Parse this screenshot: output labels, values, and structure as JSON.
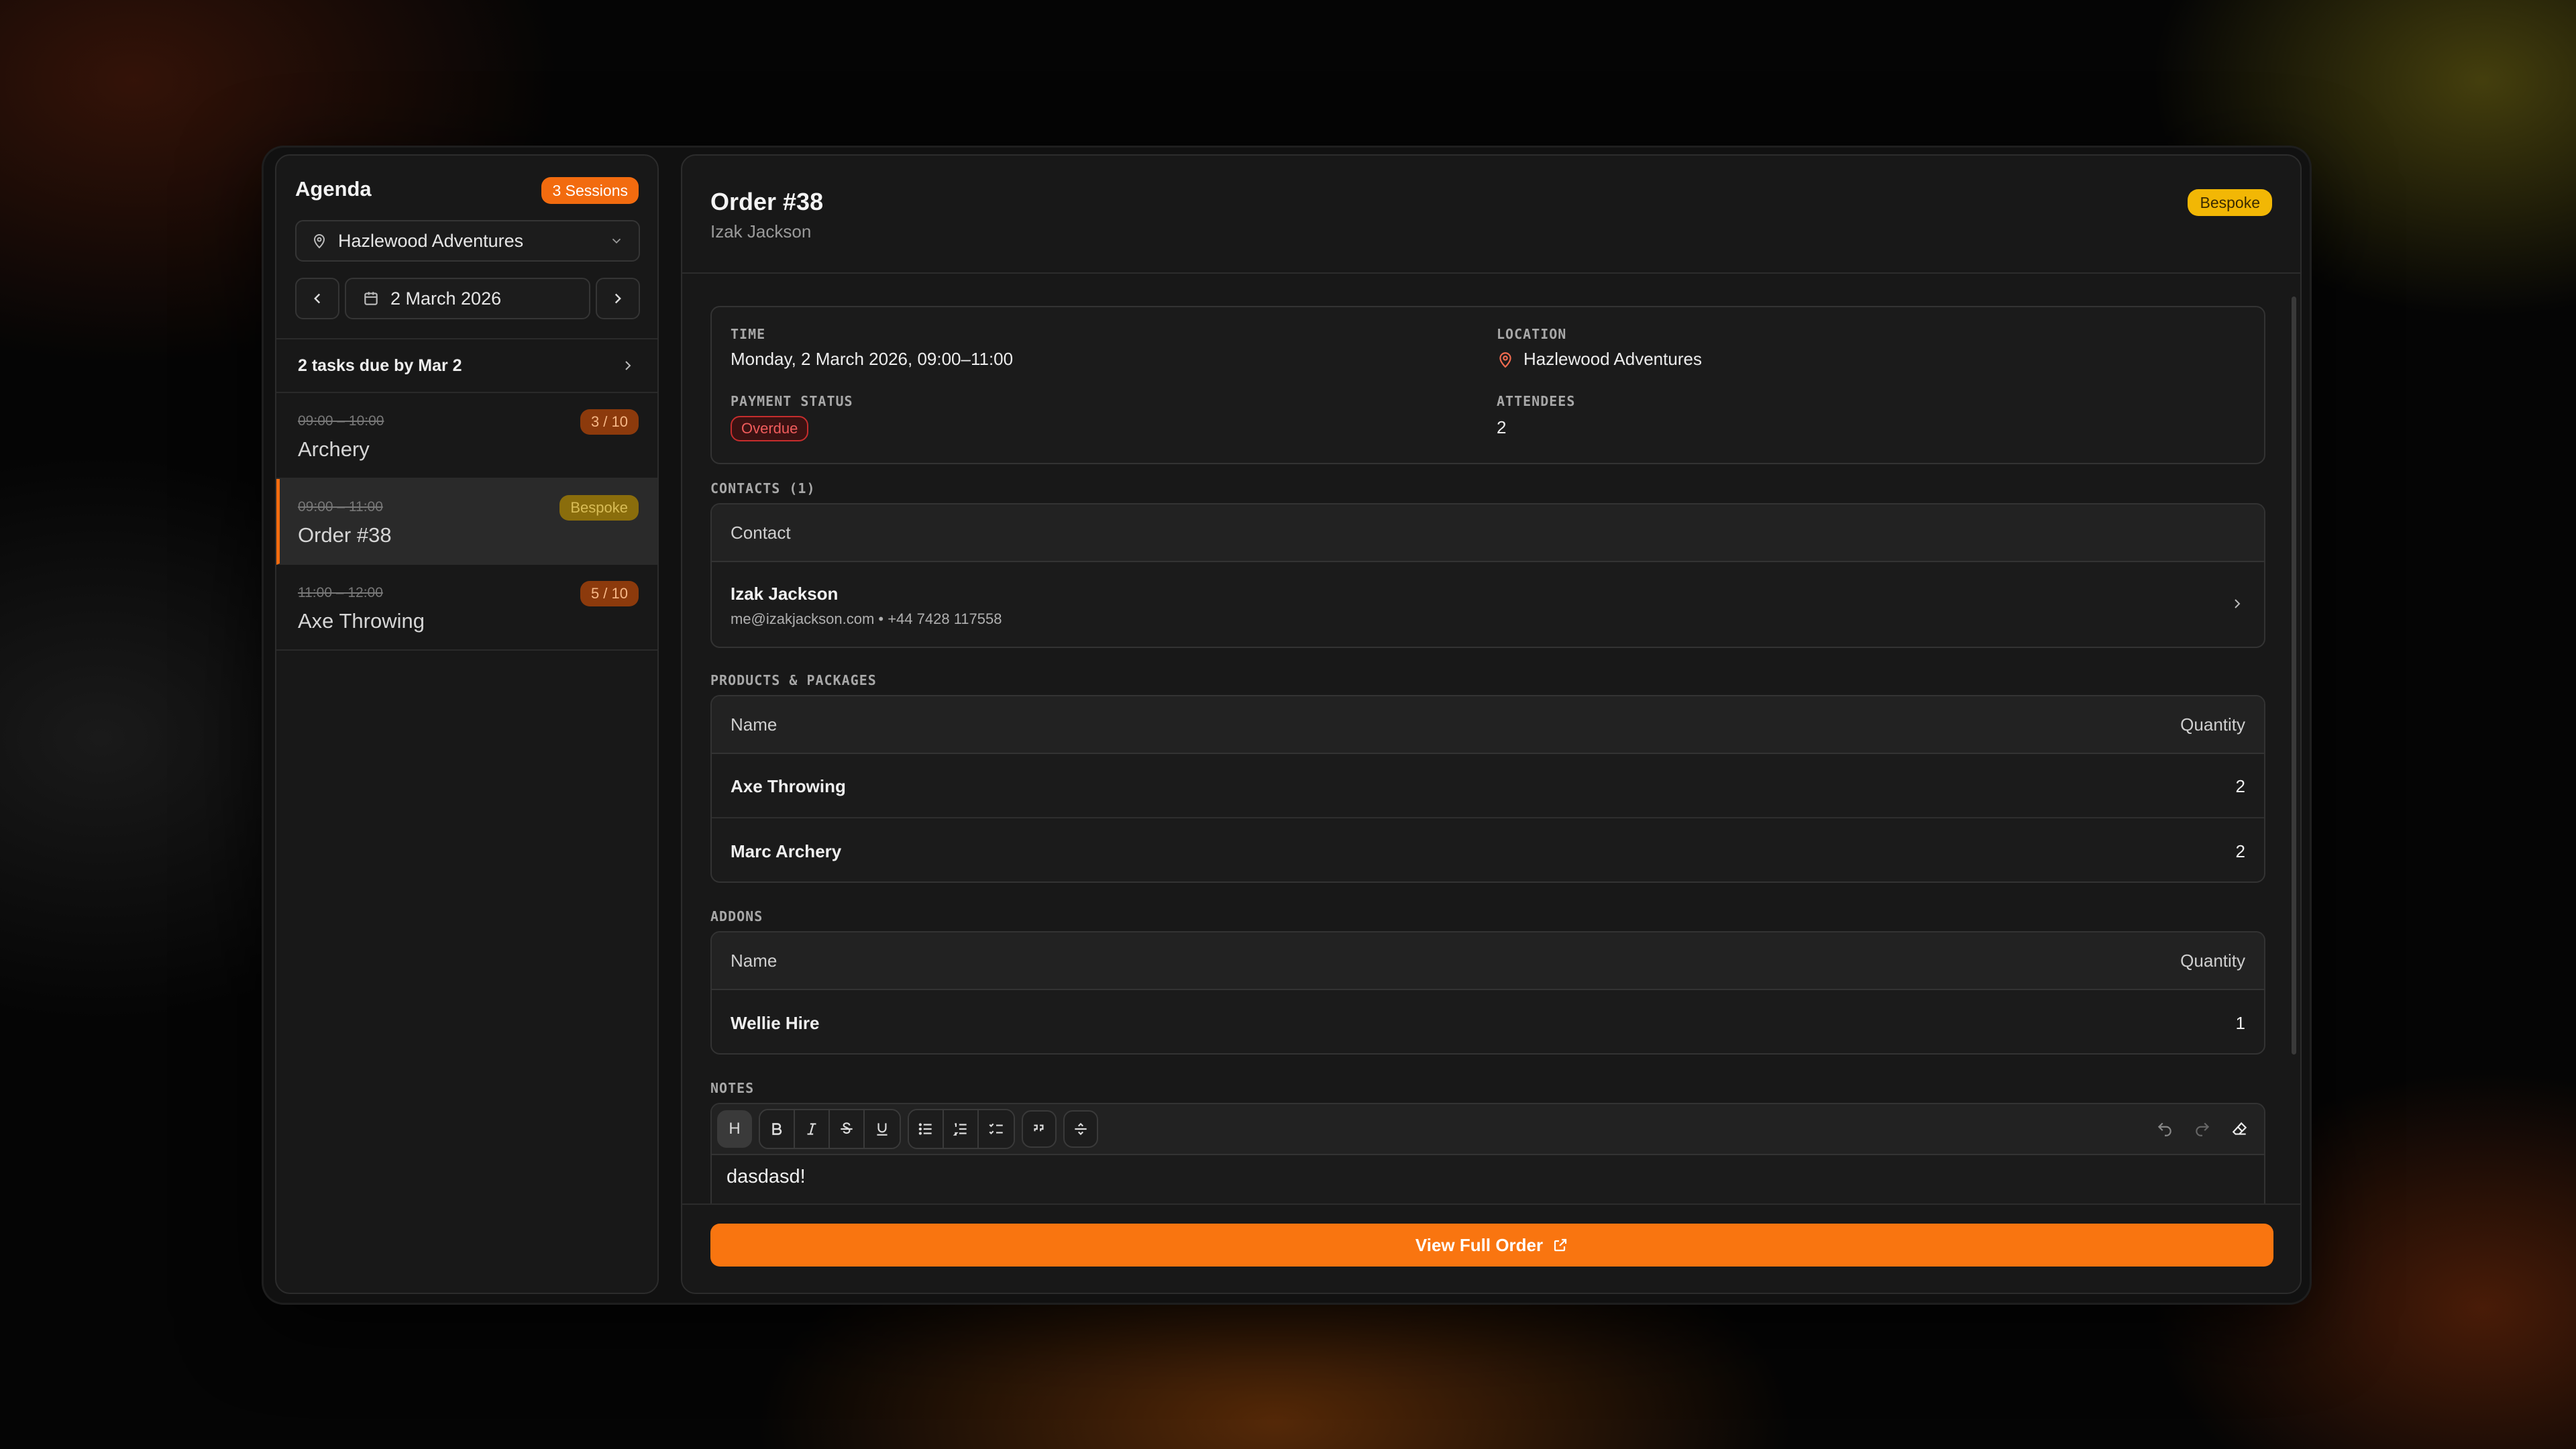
{
  "sidebar": {
    "title": "Agenda",
    "sessions_badge": "3 Sessions",
    "location": "Hazlewood Adventures",
    "date": "2 March 2026",
    "tasks": "2 tasks due by Mar 2",
    "sessions": [
      {
        "time": "09:00 – 10:00",
        "name": "Archery",
        "badge": "3 / 10"
      },
      {
        "time": "09:00 – 11:00",
        "name": "Order #38",
        "badge": "Bespoke"
      },
      {
        "time": "11:00 – 12:00",
        "name": "Axe Throwing",
        "badge": "5 / 10"
      }
    ]
  },
  "order": {
    "title": "Order #38",
    "customer": "Izak Jackson",
    "type_badge": "Bespoke",
    "time_label": "TIME",
    "time_value": "Monday, 2 March 2026, 09:00–11:00",
    "location_label": "LOCATION",
    "location_value": "Hazlewood Adventures",
    "payment_label": "PAYMENT STATUS",
    "payment_value": "Overdue",
    "attendees_label": "ATTENDEES",
    "attendees_value": "2"
  },
  "contacts": {
    "label": "CONTACTS (1)",
    "header": "Contact",
    "items": [
      {
        "name": "Izak Jackson",
        "meta": "me@izakjackson.com • +44 7428 117558"
      }
    ]
  },
  "products": {
    "label": "PRODUCTS & PACKAGES",
    "col_name": "Name",
    "col_qty": "Quantity",
    "rows": [
      {
        "name": "Axe Throwing",
        "qty": "2"
      },
      {
        "name": "Marc Archery",
        "qty": "2"
      }
    ]
  },
  "addons": {
    "label": "ADDONS",
    "col_name": "Name",
    "col_qty": "Quantity",
    "rows": [
      {
        "name": "Wellie Hire",
        "qty": "1"
      }
    ]
  },
  "notes": {
    "label": "NOTES",
    "heading_btn": "H",
    "text": "dasdasd!"
  },
  "footer": {
    "cta": "View Full Order"
  },
  "colors": {
    "accent": "#f97510",
    "bespoke": "#f2b705",
    "overdue": "#f05c5c"
  }
}
